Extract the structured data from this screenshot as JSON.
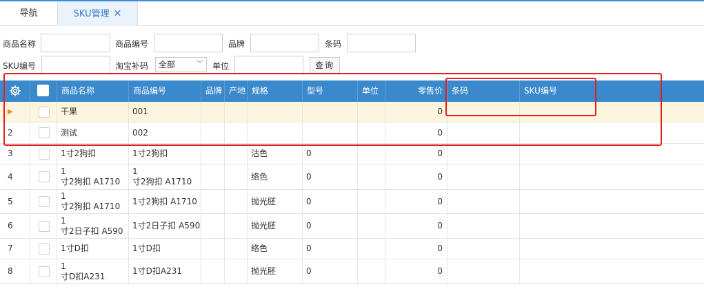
{
  "tabs": {
    "nav_label": "导航",
    "sku_label": "SKU管理",
    "close_glyph": "✕"
  },
  "filters": {
    "product_name_label": "商品名称",
    "product_code_label": "商品编号",
    "brand_label": "品牌",
    "barcode_label": "条码",
    "sku_code_label": "SKU编号",
    "taobao_label": "淘宝补码",
    "taobao_value": "全部",
    "unit_label": "单位",
    "query_button": "查询"
  },
  "grid": {
    "settings_icon": "gear-icon",
    "columns": [
      "商品名称",
      "商品编号",
      "品牌",
      "产地",
      "规格",
      "型号",
      "单位",
      "零售价",
      "条码",
      "SKU编号"
    ],
    "rows": [
      {
        "num": "",
        "name": "干果",
        "code": "001",
        "brand": "",
        "origin": "",
        "spec": "",
        "model": "",
        "unit": "",
        "price": "0",
        "barcode": "",
        "sku": ""
      },
      {
        "num": "2",
        "name": "测试",
        "code": "002",
        "brand": "",
        "origin": "",
        "spec": "",
        "model": "",
        "unit": "",
        "price": "0",
        "barcode": "",
        "sku": ""
      },
      {
        "num": "3",
        "name": "1寸2狗扣",
        "code": "1寸2狗扣",
        "brand": "",
        "origin": "",
        "spec": "沽色",
        "model": "0",
        "unit": "",
        "price": "0",
        "barcode": "",
        "sku": ""
      },
      {
        "num": "4",
        "name": "1\n寸2狗扣  A1710",
        "code": "1\n寸2狗扣  A1710",
        "brand": "",
        "origin": "",
        "spec": "络色",
        "model": "0",
        "unit": "",
        "price": "0",
        "barcode": "",
        "sku": ""
      },
      {
        "num": "5",
        "name": "1\n寸2狗扣  A1710",
        "code": "1寸2狗扣  A1710",
        "brand": "",
        "origin": "",
        "spec": "抛光胚",
        "model": "0",
        "unit": "",
        "price": "0",
        "barcode": "",
        "sku": ""
      },
      {
        "num": "6",
        "name": "1\n寸2日子扣 A590",
        "code": "1寸2日子扣 A590",
        "brand": "",
        "origin": "",
        "spec": "抛光胚",
        "model": "0",
        "unit": "",
        "price": "0",
        "barcode": "",
        "sku": ""
      },
      {
        "num": "7",
        "name": "1寸D扣",
        "code": "1寸D扣",
        "brand": "",
        "origin": "",
        "spec": "络色",
        "model": "0",
        "unit": "",
        "price": "0",
        "barcode": "",
        "sku": ""
      },
      {
        "num": "8",
        "name": "1\n寸D扣A231",
        "code": "1寸D扣A231",
        "brand": "",
        "origin": "",
        "spec": "抛光胚",
        "model": "0",
        "unit": "",
        "price": "0",
        "barcode": "",
        "sku": ""
      }
    ]
  },
  "colors": {
    "accent": "#3a89cc",
    "selected_row": "#fdf5dd",
    "highlight": "#e02020"
  }
}
